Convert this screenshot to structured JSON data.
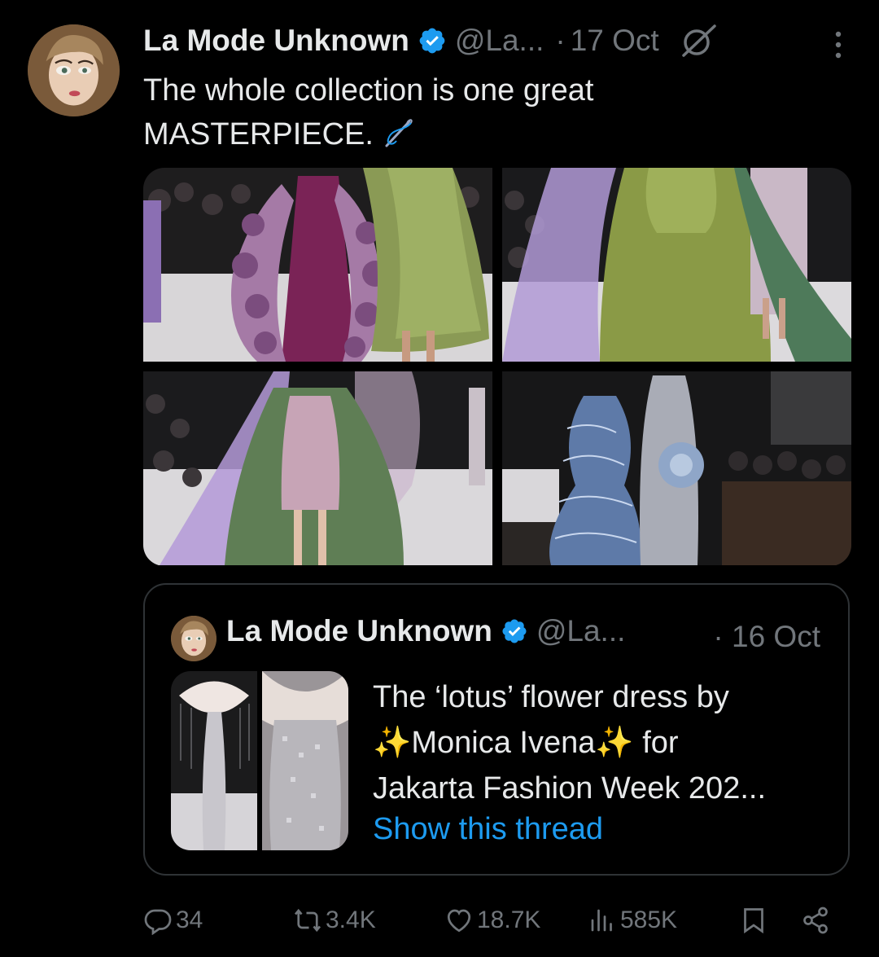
{
  "tweet": {
    "author_name": "La Mode Unknown",
    "handle": "@La...",
    "separator": "·",
    "date": "17 Oct",
    "text_line1": "The whole collection is one great",
    "text_line2": "MASTERPIECE.",
    "text_emoji": "needle-icon"
  },
  "media": {
    "images": [
      "runway-purple-floral-and-green-gowns",
      "runway-green-gown-lilac-cape",
      "runway-green-cape-mini-dress",
      "runway-blue-ruffle-gown-and-silver-gown"
    ]
  },
  "quote": {
    "author_name": "La Mode Unknown",
    "handle": "@La...",
    "separator": "·",
    "date": "16 Oct",
    "line1": "The ‘lotus’ flower dress by",
    "line2_sparkle_a": "✨",
    "line2_name": "Monica Ivena",
    "line2_sparkle_b": "✨",
    "line2_rest": " for",
    "line3": "Jakarta Fashion Week 202...",
    "show_thread": "Show this thread"
  },
  "actions": {
    "replies": "34",
    "reposts": "3.4K",
    "likes": "18.7K",
    "views": "585K"
  },
  "colors": {
    "background": "#000000",
    "text": "#e7e9ea",
    "muted": "#71767b",
    "link": "#1d9bf0",
    "verified": "#1d9bf0",
    "border": "#2f3336"
  }
}
